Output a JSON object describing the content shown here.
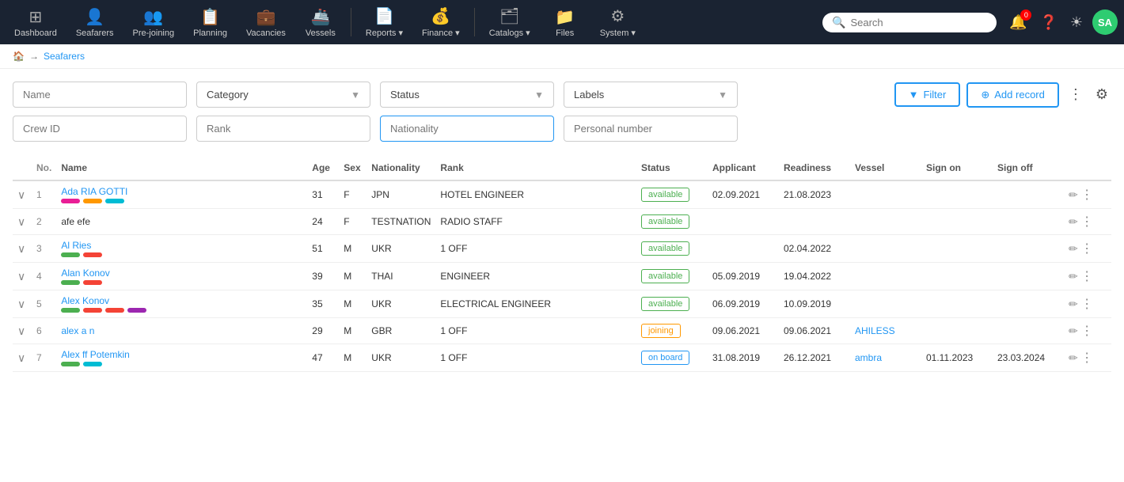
{
  "topnav": {
    "items": [
      {
        "id": "dashboard",
        "label": "Dashboard",
        "icon": "⊞"
      },
      {
        "id": "seafarers",
        "label": "Seafarers",
        "icon": "👤"
      },
      {
        "id": "prejoining",
        "label": "Pre-joining",
        "icon": "👥"
      },
      {
        "id": "planning",
        "label": "Planning",
        "icon": "📋"
      },
      {
        "id": "vacancies",
        "label": "Vacancies",
        "icon": "💼"
      },
      {
        "id": "vessels",
        "label": "Vessels",
        "icon": "🚢"
      },
      {
        "id": "reports",
        "label": "Reports",
        "icon": "📄",
        "hasDropdown": true
      },
      {
        "id": "finance",
        "label": "Finance",
        "icon": "💰",
        "hasDropdown": true
      },
      {
        "id": "catalogs",
        "label": "Catalogs",
        "icon": "🗂",
        "hasDropdown": true
      },
      {
        "id": "files",
        "label": "Files",
        "icon": "📁"
      },
      {
        "id": "system",
        "label": "System",
        "icon": "⚙",
        "hasDropdown": true
      }
    ],
    "search_placeholder": "Search",
    "avatar_initials": "SA",
    "reports_badge": "0 Reports"
  },
  "breadcrumb": {
    "home": "🏠",
    "separator": "→",
    "current": "Seafarers"
  },
  "filters": {
    "row1": {
      "name_placeholder": "Name",
      "category_placeholder": "Category",
      "status_placeholder": "Status",
      "labels_placeholder": "Labels"
    },
    "row2": {
      "crewid_placeholder": "Crew ID",
      "rank_placeholder": "Rank",
      "nationality_placeholder": "Nationality",
      "personalnumber_placeholder": "Personal number"
    },
    "filter_btn": "Filter",
    "add_btn": "Add record"
  },
  "table": {
    "columns": [
      "No.",
      "Name",
      "Age",
      "Sex",
      "Nationality",
      "Rank",
      "Status",
      "Applicant",
      "Readiness",
      "Vessel",
      "Sign on",
      "Sign off",
      ""
    ],
    "rows": [
      {
        "no": 1,
        "name": "Ada RIA GOTTI",
        "name_link": true,
        "age": 31,
        "sex": "F",
        "nationality": "JPN",
        "rank": "HOTEL ENGINEER",
        "status": "available",
        "applicant": "02.09.2021",
        "readiness": "21.08.2023",
        "vessel": "",
        "sign_on": "",
        "sign_off": "",
        "tags": [
          "pink",
          "orange",
          "cyan"
        ]
      },
      {
        "no": 2,
        "name": "afe efe",
        "name_link": false,
        "age": 24,
        "sex": "F",
        "nationality": "TESTNATION",
        "rank": "RADIO STAFF",
        "status": "available",
        "applicant": "",
        "readiness": "",
        "vessel": "",
        "sign_on": "",
        "sign_off": "",
        "tags": []
      },
      {
        "no": 3,
        "name": "Al Ries",
        "name_link": true,
        "age": 51,
        "sex": "M",
        "nationality": "UKR",
        "rank": "1 OFF",
        "status": "available",
        "applicant": "",
        "readiness": "02.04.2022",
        "vessel": "",
        "sign_on": "",
        "sign_off": "",
        "tags": [
          "green",
          "red"
        ]
      },
      {
        "no": 4,
        "name": "Alan Konov",
        "name_link": true,
        "age": 39,
        "sex": "M",
        "nationality": "THAI",
        "rank": "ENGINEER",
        "status": "available",
        "applicant": "05.09.2019",
        "readiness": "19.04.2022",
        "vessel": "",
        "sign_on": "",
        "sign_off": "",
        "tags": [
          "green",
          "red"
        ]
      },
      {
        "no": 5,
        "name": "Alex Konov",
        "name_link": true,
        "age": 35,
        "sex": "M",
        "nationality": "UKR",
        "rank": "ELECTRICAL ENGINEER",
        "status": "available",
        "applicant": "06.09.2019",
        "readiness": "10.09.2019",
        "vessel": "",
        "sign_on": "",
        "sign_off": "",
        "tags": [
          "green",
          "red",
          "red",
          "purple"
        ]
      },
      {
        "no": 6,
        "name": "alex a n",
        "name_link": true,
        "age": 29,
        "sex": "M",
        "nationality": "GBR",
        "rank": "1 OFF",
        "status": "joining",
        "applicant": "09.06.2021",
        "readiness": "09.06.2021",
        "vessel": "AHILESS",
        "vessel_link": true,
        "sign_on": "",
        "sign_off": "",
        "tags": []
      },
      {
        "no": 7,
        "name": "Alex ff Potemkin",
        "name_link": true,
        "age": 47,
        "sex": "M",
        "nationality": "UKR",
        "rank": "1 OFF",
        "status": "on board",
        "applicant": "31.08.2019",
        "readiness": "26.12.2021",
        "vessel": "ambra",
        "vessel_link": true,
        "sign_on": "01.11.2023",
        "sign_off": "23.03.2024",
        "tags": [
          "green",
          "cyan"
        ]
      }
    ]
  }
}
